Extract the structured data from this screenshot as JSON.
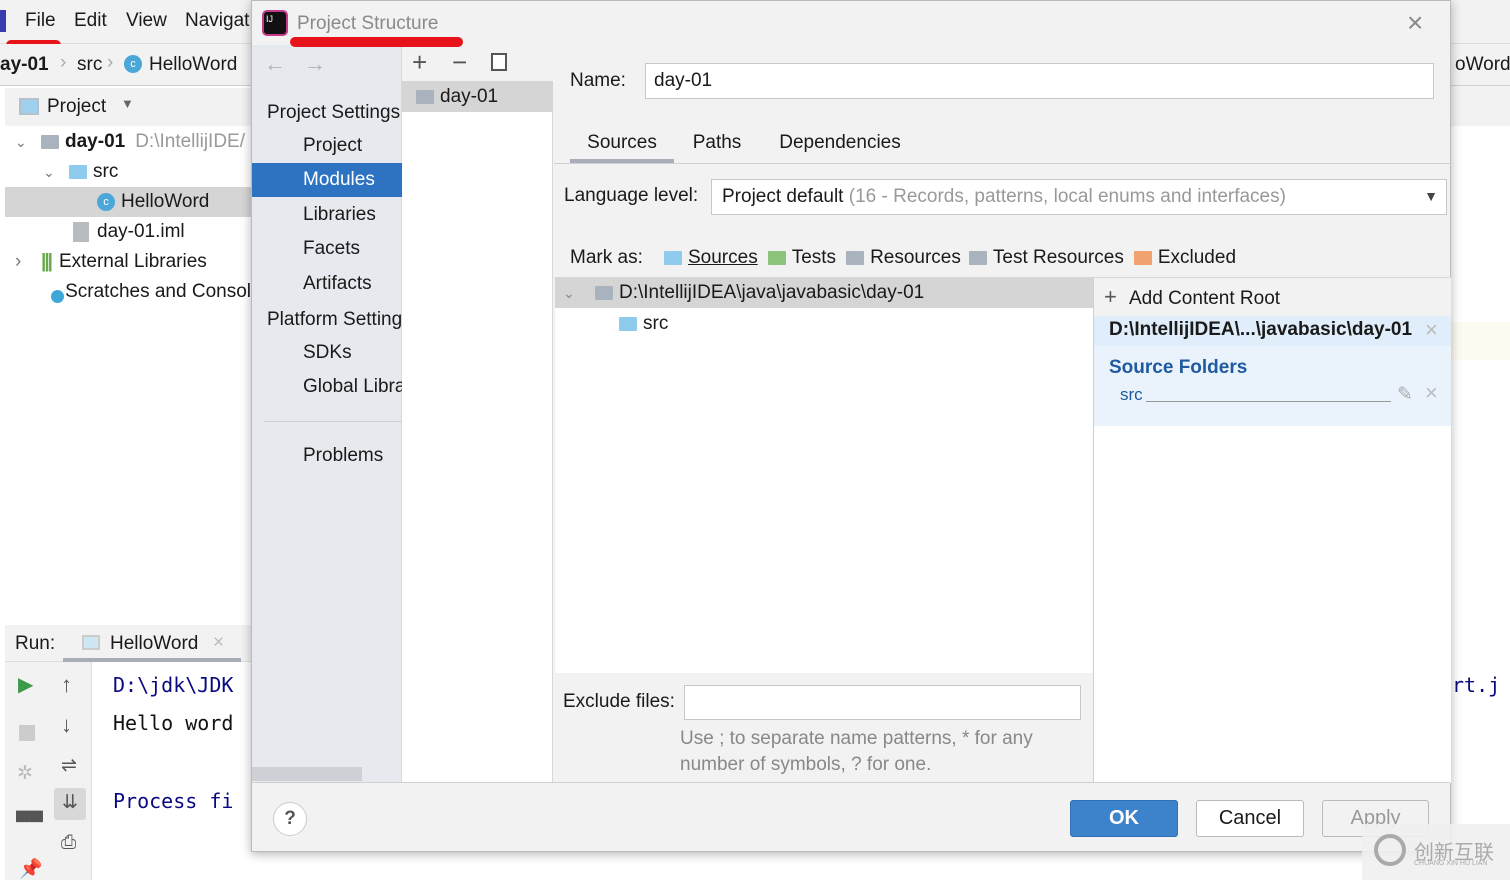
{
  "ide": {
    "menu": [
      "File",
      "Edit",
      "View",
      "Navigat"
    ],
    "breadcrumb": [
      "ay-01",
      "src",
      "HelloWord"
    ],
    "right_tab_fragment": "oWord",
    "project_view_label": "Project",
    "tree": [
      {
        "label": "day-01",
        "path": "D:\\IntellijIDE/"
      },
      {
        "label": "src"
      },
      {
        "label": "HelloWord"
      },
      {
        "label": "day-01.iml"
      },
      {
        "label": "External Libraries"
      },
      {
        "label": "Scratches and Consol"
      }
    ],
    "run": {
      "label": "Run:",
      "tab": "HelloWord",
      "console": [
        "D:\\jdk\\JDK",
        "Hello word",
        "Process fi"
      ],
      "right_fragment": "rt.j"
    }
  },
  "dialog": {
    "title": "Project Structure",
    "nav": {
      "project_settings": "Project Settings",
      "items1": [
        "Project",
        "Modules",
        "Libraries",
        "Facets",
        "Artifacts"
      ],
      "platform_settings": "Platform Settings",
      "items2": [
        "SDKs",
        "Global Libraries"
      ],
      "problems": "Problems"
    },
    "modules": [
      "day-01"
    ],
    "name_label": "Name:",
    "name_value": "day-01",
    "tabs": [
      "Sources",
      "Paths",
      "Dependencies"
    ],
    "language_label": "Language level:",
    "language_value": "Project default",
    "language_detail": "(16 - Records, patterns, local enums and interfaces)",
    "mark_as": "Mark as:",
    "mark_options": [
      "Sources",
      "Tests",
      "Resources",
      "Test Resources",
      "Excluded"
    ],
    "content_tree": [
      "D:\\IntellijIDEA\\java\\javabasic\\day-01",
      "src"
    ],
    "add_content_root": "Add Content Root",
    "content_root": "D:\\IntellijIDEA\\...\\javabasic\\day-01",
    "source_folders_title": "Source Folders",
    "source_folders": [
      "src"
    ],
    "exclude_label": "Exclude files:",
    "exclude_value": "",
    "hint1": "Use ; to separate name patterns, * for any",
    "hint2": "number of symbols, ? for one.",
    "ok": "OK",
    "cancel": "Cancel",
    "apply": "Apply",
    "help": "?"
  },
  "watermark": {
    "text": "创新互联",
    "sub": "CHUANG XIN HU LIAN"
  }
}
